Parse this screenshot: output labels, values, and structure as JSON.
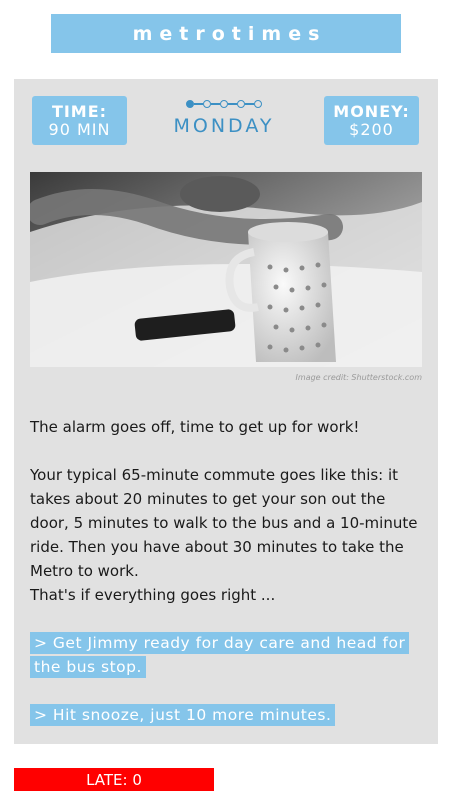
{
  "header": {
    "logo": "metrotimes"
  },
  "stats": {
    "time_label": "TIME:",
    "time_value": "90 MIN",
    "money_label": "MONEY:",
    "money_value": "$200"
  },
  "progress": {
    "steps_total": 5,
    "current_step": 1,
    "day": "MONDAY"
  },
  "image": {
    "credit": "Image credit: Shutterstock.com"
  },
  "story": {
    "line1": "The alarm goes off, time to get up for work!",
    "line2": "Your typical 65-minute commute goes like this: it takes about 20 minutes to get your son out the door, 5 minutes to walk to the bus and a 10-minute ride. Then you have about 30 minutes to take the Metro to work.",
    "line3": "That's if everything goes right ..."
  },
  "choices": [
    "> Get Jimmy ready for day care and head for the bus stop.",
    "> Hit snooze, just 10 more minutes."
  ],
  "status": {
    "late": "LATE: 0",
    "accent": "#85c5ea",
    "late_color": "#ff0000"
  }
}
